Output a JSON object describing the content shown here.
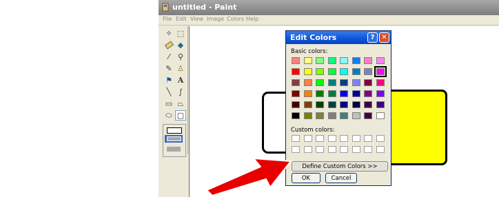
{
  "window": {
    "title": "untitled - Paint"
  },
  "menu": [
    "File",
    "Edit",
    "View",
    "Image",
    "Colors",
    "Help"
  ],
  "tools": [
    "free-select-icon",
    "rect-select-icon",
    "eraser-icon",
    "fill-icon",
    "color-picker-icon",
    "magnifier-icon",
    "pencil-icon",
    "brush-icon",
    "airbrush-icon",
    "text-icon",
    "line-icon",
    "curve-icon",
    "rectangle-icon",
    "polygon-icon",
    "ellipse-icon",
    "rounded-rect-icon"
  ],
  "dialog": {
    "title": "Edit Colors",
    "help_glyph": "?",
    "close_glyph": "✕",
    "basic_colors_label": "Basic colors:",
    "custom_colors_label": "Custom colors:",
    "define_button": "Define Custom Colors >>",
    "ok_button": "OK",
    "cancel_button": "Cancel",
    "basic_colors": [
      [
        "#ff8080",
        "#ffff80",
        "#80ff80",
        "#00ff80",
        "#80ffff",
        "#0080ff",
        "#ff80c0",
        "#ff80ff"
      ],
      [
        "#ff0000",
        "#ffff00",
        "#80ff00",
        "#00ff40",
        "#00ffff",
        "#0080c0",
        "#8080c0",
        "#ff00ff"
      ],
      [
        "#804040",
        "#ff8040",
        "#00ff00",
        "#008080",
        "#004080",
        "#8080ff",
        "#800040",
        "#ff0080"
      ],
      [
        "#800000",
        "#ff8000",
        "#008000",
        "#008040",
        "#0000ff",
        "#0000a0",
        "#800080",
        "#8000ff"
      ],
      [
        "#400000",
        "#804000",
        "#004000",
        "#004040",
        "#000080",
        "#000040",
        "#400040",
        "#400080"
      ],
      [
        "#000000",
        "#808000",
        "#808040",
        "#808080",
        "#408080",
        "#c0c0c0",
        "#400040",
        "#ffffff"
      ]
    ],
    "selected_color": "#ff00ff"
  },
  "colors": {
    "accent": "#0a54d9",
    "arrow": "#e80000",
    "shape_fill": "#ffff00"
  }
}
